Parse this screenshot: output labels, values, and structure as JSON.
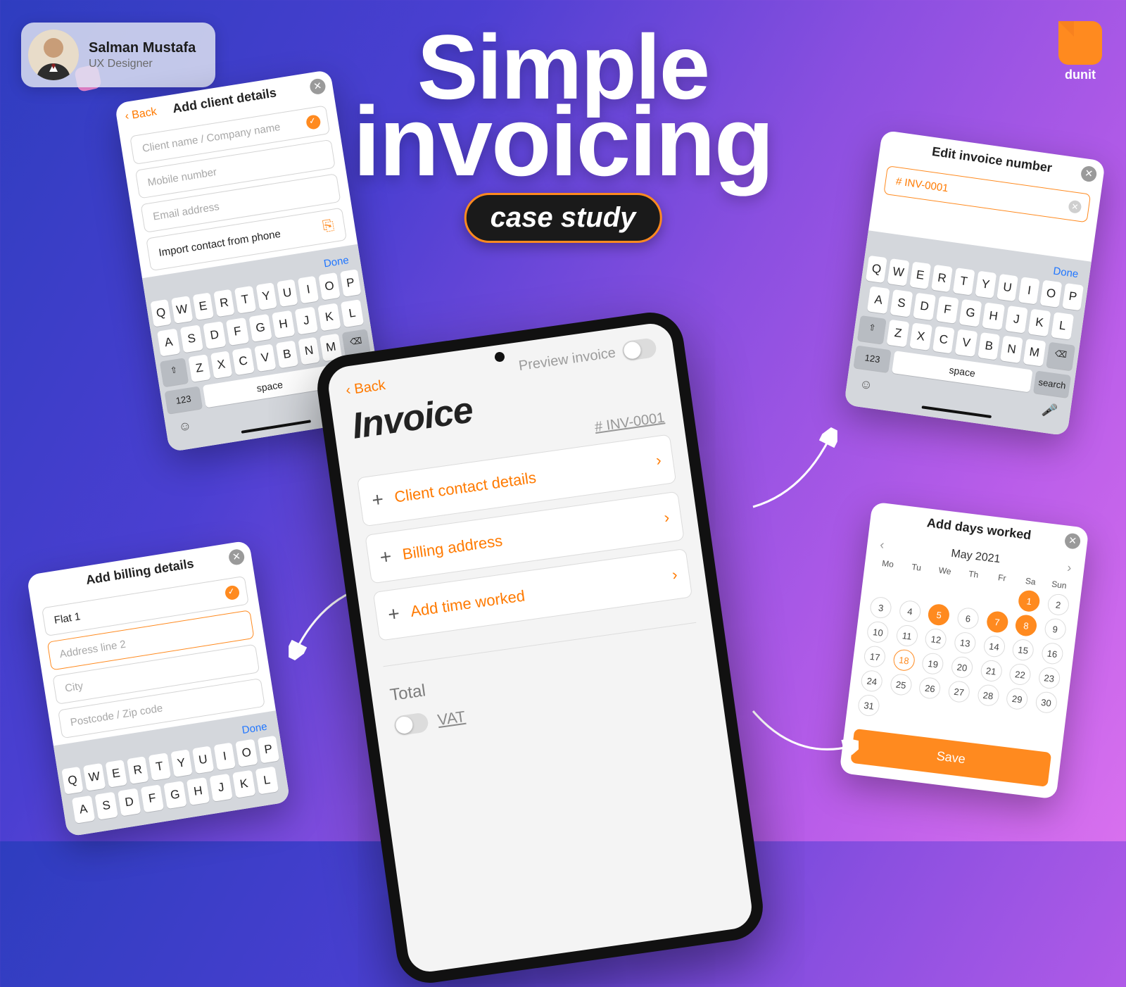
{
  "author": {
    "name": "Salman Mustafa",
    "role": "UX Designer"
  },
  "brand": {
    "name": "dunit"
  },
  "title": {
    "line1": "Simple",
    "line2": "invoicing",
    "pill": "case study"
  },
  "client_card": {
    "back": "Back",
    "title": "Add client details",
    "fields": {
      "name_ph": "Client name / Company name",
      "mobile_ph": "Mobile number",
      "email_ph": "Email address",
      "import": "Import contact from phone"
    }
  },
  "billing_card": {
    "title": "Add billing details",
    "fields": {
      "line1": "Flat 1",
      "line2_ph": "Address line 2",
      "city_ph": "City",
      "post_ph": "Postcode / Zip code"
    }
  },
  "editinv_card": {
    "title": "Edit invoice number",
    "value": "# INV-0001"
  },
  "days_card": {
    "title": "Add days worked",
    "month": "May 2021",
    "dow": [
      "Mo",
      "Tu",
      "We",
      "Th",
      "Fr",
      "Sa",
      "Sun"
    ],
    "save": "Save"
  },
  "main": {
    "back": "Back",
    "preview": "Preview invoice",
    "heading": "Invoice",
    "inv_num": "# INV-0001",
    "rows": {
      "client": "Client contact details",
      "billing": "Billing address",
      "time": "Add time worked"
    },
    "total": "Total",
    "vat": "VAT"
  },
  "kb": {
    "done": "Done",
    "row1": [
      "Q",
      "W",
      "E",
      "R",
      "T",
      "Y",
      "U",
      "I",
      "O",
      "P"
    ],
    "row2": [
      "A",
      "S",
      "D",
      "F",
      "G",
      "H",
      "J",
      "K",
      "L"
    ],
    "row3": [
      "Z",
      "X",
      "C",
      "V",
      "B",
      "N",
      "M"
    ],
    "num": "123",
    "space": "space",
    "search": "search"
  }
}
